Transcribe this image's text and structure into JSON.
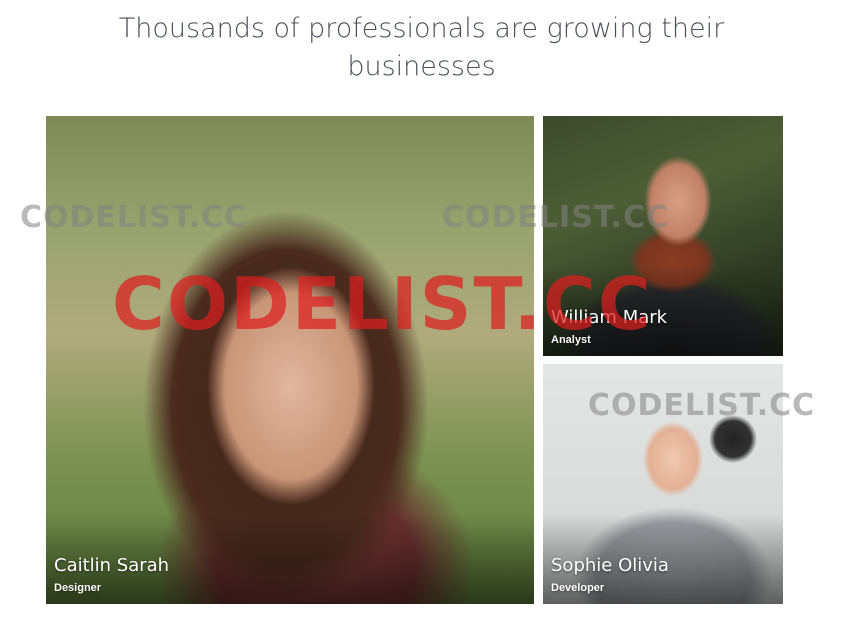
{
  "headline": {
    "line1": "Thousands of professionals are growing their",
    "line2": "businesses"
  },
  "profiles": [
    {
      "name": "Caitlin Sarah",
      "role": "Designer"
    },
    {
      "name": "William Mark",
      "role": "Analyst"
    },
    {
      "name": "Sophie Olivia",
      "role": "Developer"
    }
  ],
  "watermark": {
    "main": "CODELIST.CC",
    "grey": "CODELIST.CC"
  }
}
